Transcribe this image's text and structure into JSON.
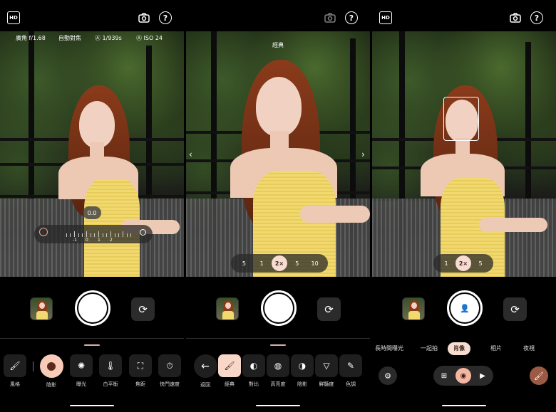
{
  "panel1": {
    "badge_icon": "HDR-badge-icon",
    "top_icons": [
      "camera-settings-icon",
      "help-icon"
    ],
    "info": {
      "lens": "廣角 f/1.68",
      "focus": "自動對焦",
      "shutter": "1/939s",
      "iso": "ISO 24"
    },
    "exposure": {
      "value": "0.0",
      "scale": [
        "-1",
        "0",
        "1",
        "2"
      ]
    },
    "tools": [
      {
        "label": "風格",
        "icon": "paint-bucket-icon"
      },
      {
        "label": "陰影",
        "icon": "shadow-icon",
        "active": true
      },
      {
        "label": "曝光",
        "icon": "exposure-icon"
      },
      {
        "label": "白平衡",
        "icon": "white-balance-icon"
      },
      {
        "label": "焦距",
        "icon": "focus-frame-icon"
      },
      {
        "label": "快門速度",
        "icon": "shutter-speed-icon"
      }
    ]
  },
  "panel2": {
    "top_icons": [
      "camera-settings-icon",
      "help-icon"
    ],
    "style_label": "經典",
    "zoom": [
      "5",
      "1",
      "2×",
      "5",
      "10"
    ],
    "zoom_active": "2×",
    "tools": [
      {
        "label": "返回",
        "icon": "back-arrow-icon"
      },
      {
        "label": "經典",
        "icon": "paint-bucket-icon",
        "active": true
      },
      {
        "label": "對比",
        "icon": "contrast-icon"
      },
      {
        "label": "高亮度",
        "icon": "highlight-icon"
      },
      {
        "label": "陰影",
        "icon": "shadow-icon"
      },
      {
        "label": "鮮豔度",
        "icon": "vibrance-icon"
      },
      {
        "label": "色調",
        "icon": "tone-icon"
      }
    ]
  },
  "panel3": {
    "top_icons": [
      "camera-settings-icon",
      "help-icon"
    ],
    "zoom": [
      "1",
      "2×",
      "5"
    ],
    "zoom_active": "2×",
    "modes": [
      "長時間曝光",
      "一起拍",
      "肖像",
      "相片",
      "夜視"
    ],
    "mode_active": "肖像",
    "switch": [
      "photo-add-icon",
      "camera-icon",
      "video-icon"
    ],
    "switch_active": "camera-icon"
  },
  "colors": {
    "accent": "#f7dcd2",
    "accent_dark": "#3a1f15",
    "dress": "#f1d970",
    "hair": "#8a3b1a"
  }
}
